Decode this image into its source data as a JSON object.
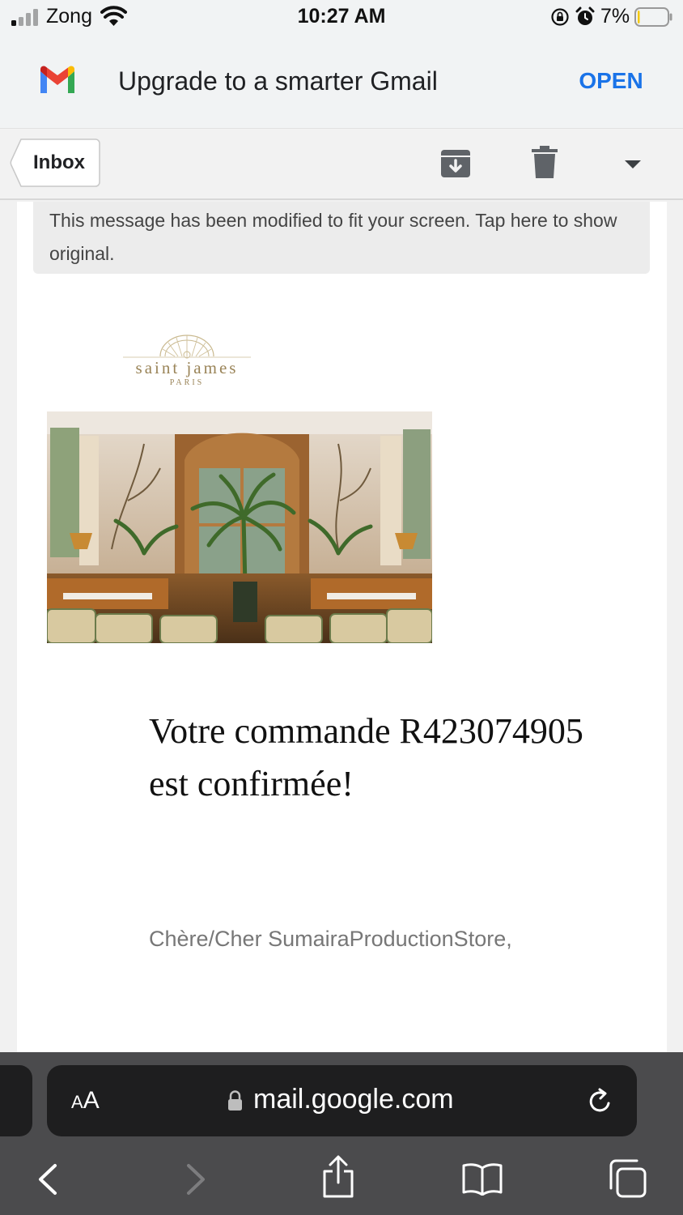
{
  "status_bar": {
    "carrier": "Zong",
    "time": "10:27 AM",
    "battery_percent": "7%",
    "battery_level": 0.07,
    "icons": [
      "signal-icon",
      "wifi-icon",
      "rotation-lock-icon",
      "alarm-icon",
      "battery-icon"
    ]
  },
  "gmail_banner": {
    "text": "Upgrade to a smarter Gmail",
    "open_label": "OPEN",
    "accent_color": "#1a73e8"
  },
  "toolbar": {
    "back_label": "Inbox",
    "icons": [
      "archive-icon",
      "trash-icon",
      "more-options-icon"
    ]
  },
  "email": {
    "notice": "This message has been modified to fit your screen. Tap here to show original.",
    "brand": {
      "name": "saint james",
      "city": "PARIS"
    },
    "hero_image": "restaurant-interior-photo",
    "heading": "Votre commande R423074905 est confirmée!",
    "greeting": "Chère/Cher SumairaProductionStore,"
  },
  "browser": {
    "aa_big": "A",
    "aa_small": "A",
    "url": "mail.google.com",
    "icons": [
      "lock-icon",
      "reload-icon",
      "back-icon",
      "forward-icon",
      "share-icon",
      "bookmarks-icon",
      "tabs-icon"
    ]
  }
}
